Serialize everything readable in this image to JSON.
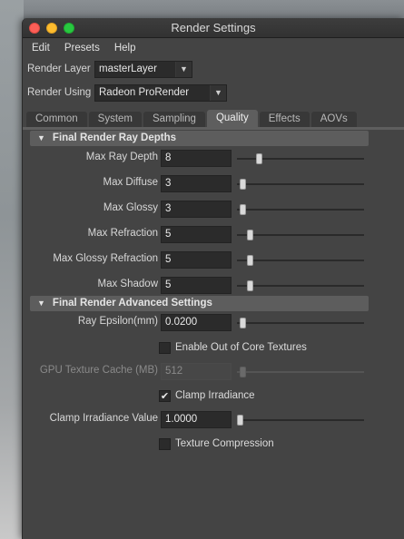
{
  "window": {
    "title": "Render Settings"
  },
  "menu": [
    "Edit",
    "Presets",
    "Help"
  ],
  "render_layer": {
    "label": "Render Layer",
    "value": "masterLayer"
  },
  "render_using": {
    "label": "Render Using",
    "value": "Radeon ProRender"
  },
  "tabs": [
    "Common",
    "System",
    "Sampling",
    "Quality",
    "Effects",
    "AOVs"
  ],
  "active_tab": "Quality",
  "sections": {
    "ray_depths": {
      "title": "Final Render Ray Depths",
      "fields": [
        {
          "label": "Max Ray Depth",
          "value": "8",
          "slider_fraction": 0.15
        },
        {
          "label": "Max Diffuse",
          "value": "3",
          "slider_fraction": 0.02
        },
        {
          "label": "Max Glossy",
          "value": "3",
          "slider_fraction": 0.02
        },
        {
          "label": "Max Refraction",
          "value": "5",
          "slider_fraction": 0.08
        },
        {
          "label": "Max Glossy Refraction",
          "value": "5",
          "slider_fraction": 0.08
        },
        {
          "label": "Max Shadow",
          "value": "5",
          "slider_fraction": 0.08
        }
      ]
    },
    "advanced": {
      "title": "Final Render Advanced Settings",
      "ray_epsilon": {
        "label": "Ray Epsilon(mm)",
        "value": "0.0200",
        "slider_fraction": 0.02
      },
      "out_of_core": {
        "label": "Enable Out of Core Textures",
        "checked": false
      },
      "gpu_cache": {
        "label": "GPU Texture Cache (MB)",
        "value": "512",
        "slider_fraction": 0.02,
        "disabled": true
      },
      "clamp_irradiance": {
        "label": "Clamp Irradiance",
        "checked": true
      },
      "clamp_value": {
        "label": "Clamp Irradiance Value",
        "value": "1.0000",
        "slider_fraction": 0.0
      },
      "texture_compression": {
        "label": "Texture Compression",
        "checked": false
      }
    }
  }
}
